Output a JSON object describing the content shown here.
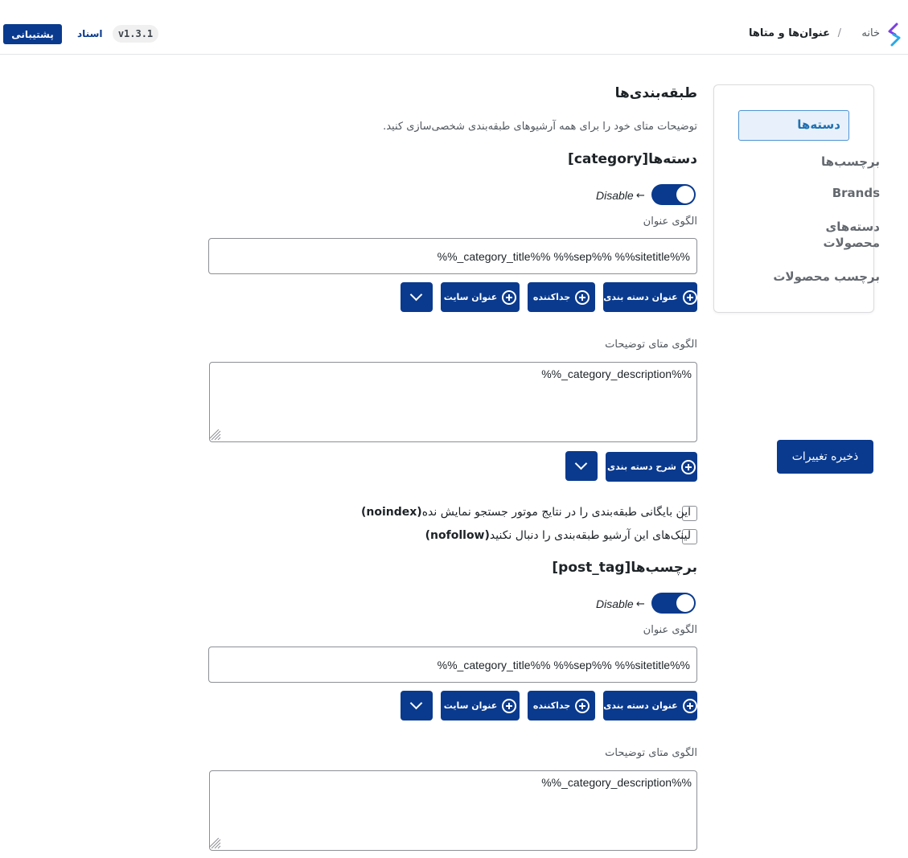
{
  "header": {
    "breadcrumb_home": "خانه",
    "breadcrumb_sep": "/",
    "breadcrumb_current": "عنوان‌ها و متاها",
    "support_label": "پشتیبانی",
    "docs_label": "اسناد",
    "version": "v1.3.1"
  },
  "sidebar": {
    "items": [
      {
        "label": "دسته‌ها",
        "active": true
      },
      {
        "label": "برچسب‌ها"
      },
      {
        "label": "Brands"
      },
      {
        "label": "دسته‌های محصولات"
      },
      {
        "label": "برچسب محصولات"
      }
    ],
    "save_label": "ذخیره تغییرات"
  },
  "main": {
    "title": "طبقه‌بندی‌ها",
    "description": "توضیحات متای خود را برای همه آرشیوهای طبقه‌بندی شخصی‌سازی کنید.",
    "sections": [
      {
        "heading": "دسته‌ها[category]",
        "toggle_label": "Disable",
        "title_label": "الگوی عنوان",
        "title_value": "%%category_title%% %%sep%% %%sitetitle_%%",
        "title_buttons": [
          "عنوان دسته بندی",
          "جداکننده",
          "عنوان سایت"
        ],
        "desc_label": "الگوی متای توضیحات",
        "desc_value": "%%category_description_%%",
        "desc_buttons": [
          "شرح دسته بندی"
        ],
        "checkbox_noindex": "این بایگانی طبقه‌بندی را در نتایج موتور جستجو نمایش نده",
        "checkbox_noindex_tag": "(noindex)",
        "checkbox_nofollow": "لینک‌های این آرشیو طبقه‌بندی را دنبال نکنید",
        "checkbox_nofollow_tag": "(nofollow)"
      },
      {
        "heading": "برچسب‌ها[post_tag]",
        "toggle_label": "Disable",
        "title_label": "الگوی عنوان",
        "title_value": "%%category_title%% %%sep%% %%sitetitle_%%",
        "title_buttons": [
          "عنوان دسته بندی",
          "جداکننده",
          "عنوان سایت"
        ],
        "desc_label": "الگوی متای توضیحات",
        "desc_value": "%%category_description_%%"
      }
    ]
  },
  "colors": {
    "primary": "#0a3a8e",
    "active_bg": "#e8f1fb",
    "active_text": "#2271b1"
  },
  "icons": {
    "logo": "brand-logo-icon",
    "plus": "plus-circle-icon",
    "chevron": "chevron-down-icon",
    "arrow": "arrow-left-icon"
  }
}
